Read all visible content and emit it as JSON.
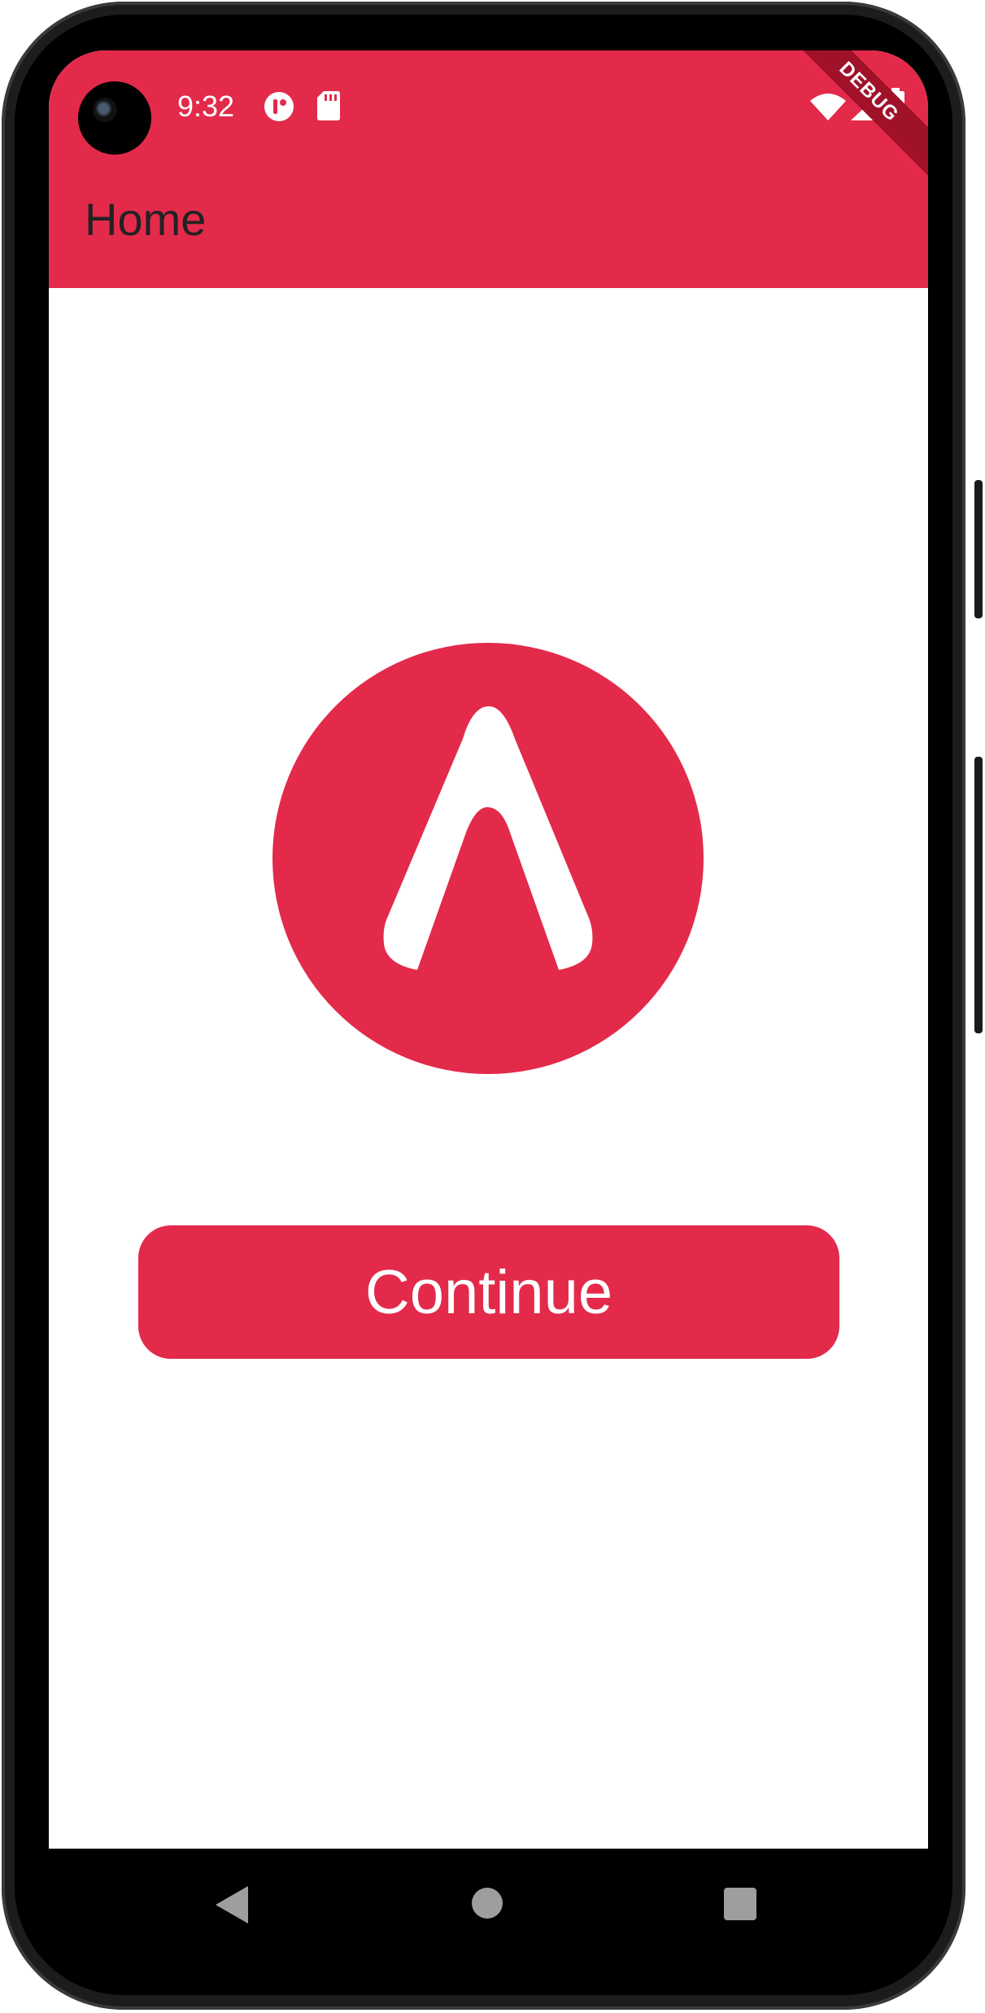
{
  "status_bar": {
    "time": "9:32",
    "icons": [
      "app-notification-icon",
      "sd-card-icon",
      "wifi-icon",
      "signal-icon",
      "battery-icon"
    ]
  },
  "debug_banner": "DEBUG",
  "app_bar": {
    "title": "Home"
  },
  "logo": {
    "icon": "brand-logo-icon"
  },
  "main": {
    "continue_label": "Continue"
  },
  "navigation": {
    "icons": [
      "back-icon",
      "home-icon",
      "recents-icon"
    ]
  },
  "colors": {
    "primary": "#e32a4b",
    "background": "#ffffff",
    "title_text": "#222222"
  }
}
